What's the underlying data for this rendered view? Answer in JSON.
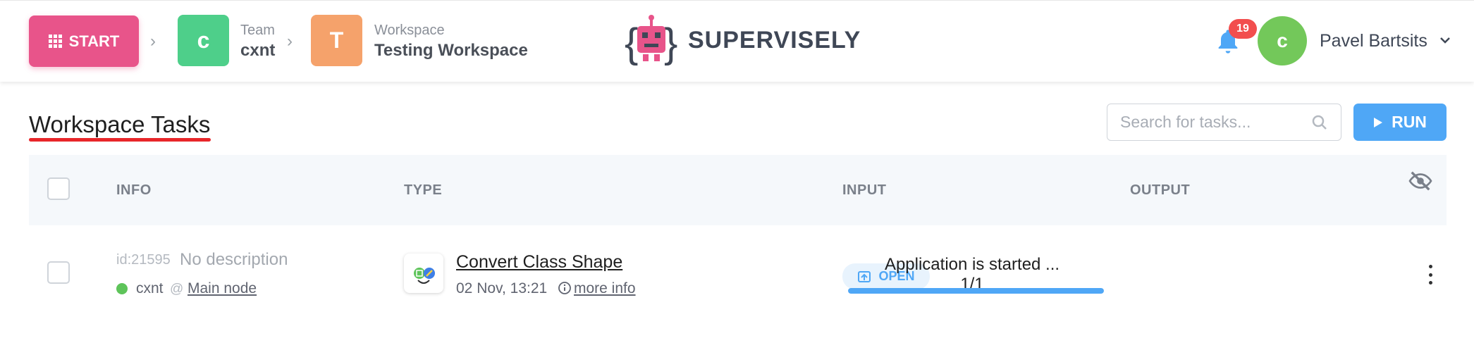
{
  "header": {
    "start_label": "START",
    "team": {
      "initial": "c",
      "label": "Team",
      "value": "cxnt",
      "color": "#4ecf8a"
    },
    "workspace": {
      "initial": "T",
      "label": "Workspace",
      "value": "Testing Workspace",
      "color": "#f5a26b"
    },
    "logo_text": "SUPERVISELY",
    "notifications_count": "19",
    "user": {
      "initial": "c",
      "name": "Pavel Bartsits"
    }
  },
  "page": {
    "title": "Workspace Tasks",
    "search_placeholder": "Search for tasks...",
    "run_label": "RUN"
  },
  "table": {
    "columns": [
      "INFO",
      "TYPE",
      "INPUT",
      "OUTPUT"
    ],
    "rows": [
      {
        "id": "id:21595",
        "description": "No description",
        "team": "cxnt",
        "at": "@",
        "node": "Main node",
        "app_name": "Convert Class Shape",
        "date": "02 Nov, 13:21",
        "more_info": "more info",
        "input_label": "OPEN",
        "output_text": "Application is started ... 1/1",
        "progress": 1.0
      }
    ]
  },
  "colors": {
    "accent": "#4fa7f6",
    "start": "#e8548a",
    "badge": "#f24e4e",
    "status_ok": "#5ec45a"
  },
  "icons": [
    "grid-icon",
    "chevron-right-icon",
    "robot-logo-icon",
    "bell-icon",
    "chevron-down-icon",
    "search-icon",
    "play-icon",
    "eye-off-icon",
    "app-icon",
    "info-icon",
    "open-icon",
    "kebab-icon"
  ]
}
